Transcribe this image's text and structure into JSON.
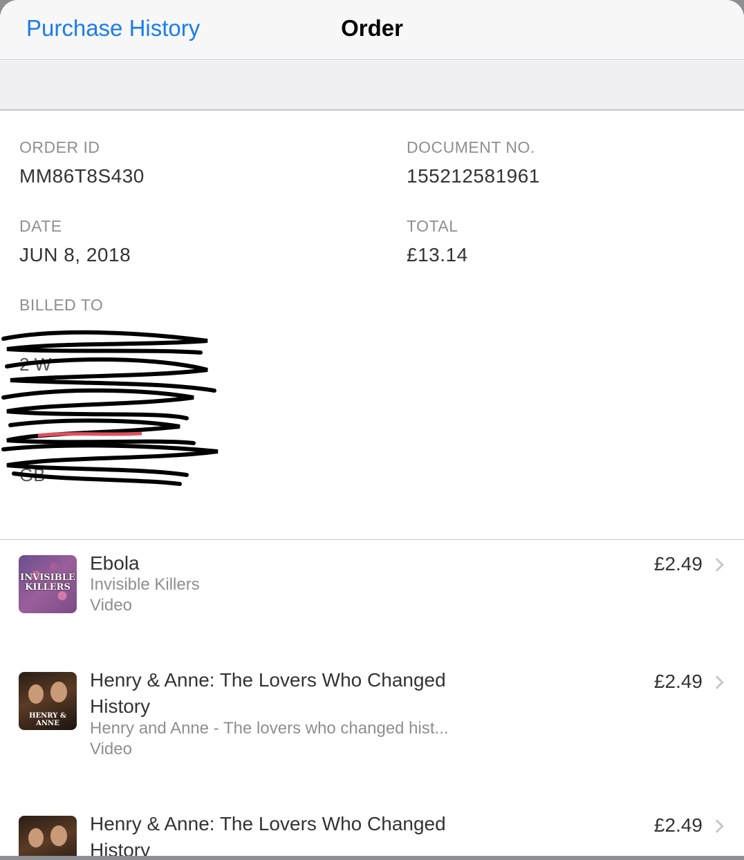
{
  "nav": {
    "back_label": "Purchase History",
    "title": "Order"
  },
  "order": {
    "order_id_label": "ORDER ID",
    "order_id": "MM86T8S430",
    "document_label": "DOCUMENT NO.",
    "document_no": "155212581961",
    "date_label": "DATE",
    "date": "JUN 8, 2018",
    "total_label": "TOTAL",
    "total": "£13.14",
    "billed_label": "BILLED TO",
    "billed_lines": [
      "",
      "2 W",
      "",
      "",
      "",
      "GB"
    ]
  },
  "items": [
    {
      "title": "Ebola",
      "subtitle": "Invisible Killers",
      "kind": "Video",
      "price": "£2.49",
      "thumb_text": "INVISIBLE KILLERS"
    },
    {
      "title": "Henry & Anne: The Lovers Who Changed History",
      "subtitle": "Henry and Anne - The lovers who changed hist...",
      "kind": "Video",
      "price": "£2.49",
      "thumb_text": "HENRY & ANNE"
    },
    {
      "title": "Henry & Anne: The Lovers Who Changed History",
      "subtitle": "",
      "kind": "",
      "price": "£2.49",
      "thumb_text": ""
    }
  ],
  "colors": {
    "accent": "#1a7cf0",
    "secondary_text": "#8e8e93",
    "separator": "#c8c7cc"
  }
}
